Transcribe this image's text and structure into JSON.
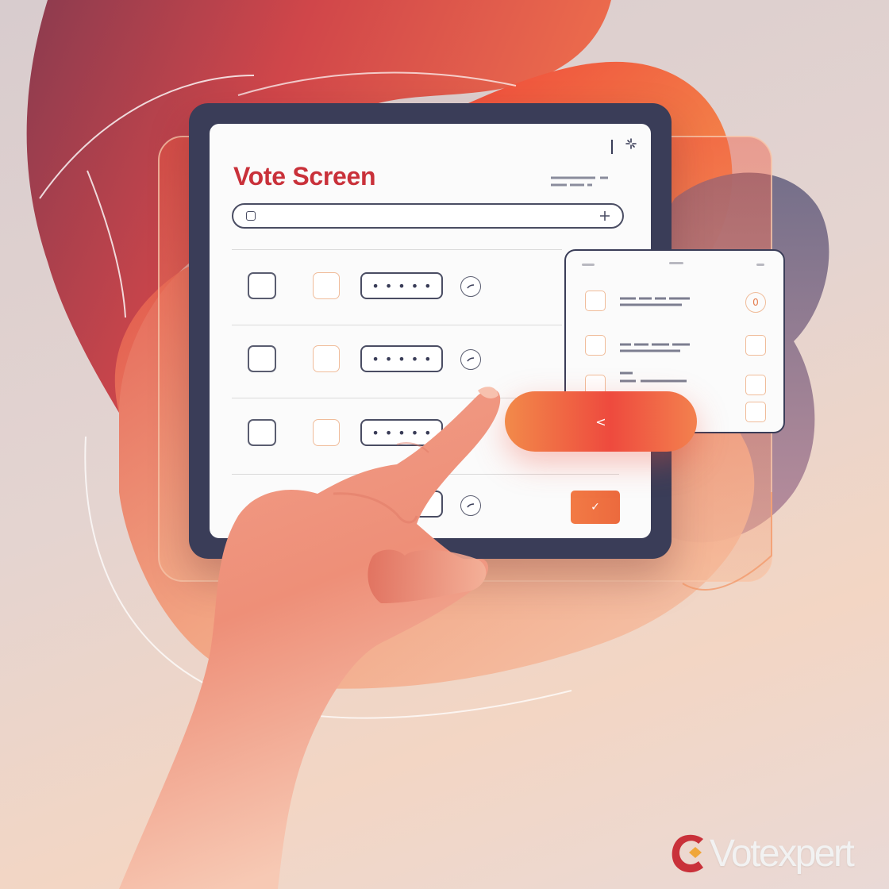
{
  "screen": {
    "title": "Vote Screen",
    "rows": [
      {
        "pin_mask": "•••••"
      },
      {
        "pin_mask": "•••••"
      },
      {
        "pin_mask": "•••••"
      },
      {
        "pin_mask": "•••"
      }
    ],
    "confirm_glyph": "✓"
  },
  "panel": {
    "badge": "0"
  },
  "pill": {
    "glyph": "<"
  },
  "logo": {
    "text": "Votexpert"
  },
  "colors": {
    "accent": "#c9313a",
    "orange": "#f27a45",
    "frame": "#3a3d58"
  },
  "icons": [
    "search-icon",
    "add-icon",
    "chevron-left-icon",
    "check-icon",
    "menu-icon"
  ]
}
